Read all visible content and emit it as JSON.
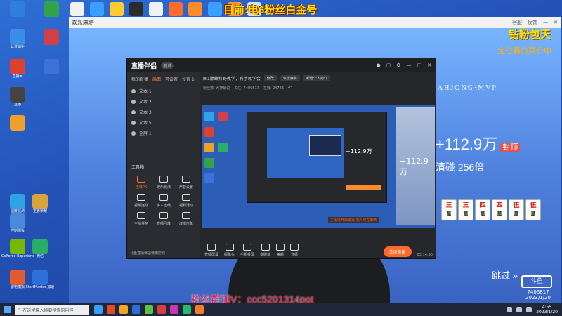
{
  "overlay": {
    "top_text": "目前:电6粉丝白金号",
    "top_right_big": "钻粉包天",
    "top_right_sub": "定位赛白菜价中",
    "fans_text": "粉丝群加V：ccc5201314pot"
  },
  "desktop_icons": [
    {
      "label": "",
      "color": "#2f7fe0"
    },
    {
      "label": "认证助手",
      "color": "#3a8ee6"
    },
    {
      "label": "直播间",
      "color": "#e0402f"
    },
    {
      "label": "直播",
      "color": "#444444"
    },
    {
      "label": "",
      "color": "#f0a02a"
    },
    {
      "label": "",
      "color": "#33a34a"
    },
    {
      "label": "",
      "color": "#d33f49"
    },
    {
      "label": "",
      "color": "#3d73d8"
    },
    {
      "label": "温度监测",
      "color": "#2fa3e6"
    },
    {
      "label": "控制面板",
      "color": "#4a8ad8"
    },
    {
      "label": "王者荣耀",
      "color": "#d8a43a"
    },
    {
      "label": "GeForce Experience",
      "color": "#76b900"
    },
    {
      "label": "微信",
      "color": "#2aae67"
    },
    {
      "label": "雷电模拟",
      "color": "#e45c2d"
    },
    {
      "label": "StartMaster 加速",
      "color": "#2d6fd8"
    }
  ],
  "top_taskbar_icons": [
    "#f2f2f2",
    "#3aa0ff",
    "#ffcb2e",
    "#2b2b2b",
    "#eef2f8",
    "#ff6b2b",
    "#ff8a2a",
    "#3aa0ff",
    "#ff9a2a",
    "#dcdcdc"
  ],
  "game_window": {
    "title": "欢乐麻将",
    "service": "客服",
    "feedback": "反馈",
    "mj_title": "MAHJONG·MVP",
    "score": "+112.9万",
    "score_badge": "封顶",
    "multiplier": "清碰 256倍",
    "tiles": [
      {
        "top": "三",
        "bottom": "萬"
      },
      {
        "top": "三",
        "bottom": "萬"
      },
      {
        "top": "四",
        "bottom": "萬"
      },
      {
        "top": "四",
        "bottom": "萬"
      },
      {
        "top": "伍",
        "bottom": "萬"
      },
      {
        "top": "伍",
        "bottom": "萬"
      }
    ],
    "skip": "跳过 »",
    "platform_logo": "斗鱼",
    "room_id": "7406817",
    "date": "2023/1/20"
  },
  "companion": {
    "brand": "直播伴侣",
    "version": "测试",
    "tabs": [
      "我的直播",
      "画面",
      "可设置",
      "设置 1"
    ],
    "active_tab": "画面",
    "sources": [
      "文本 1",
      "文本 2",
      "文本 3",
      "文本 5",
      "全屏 1"
    ],
    "tools_title": "工具箱",
    "tools": [
      {
        "label": "连线PK",
        "hot": true
      },
      {
        "label": "娱乐玩法",
        "hot": false
      },
      {
        "label": "声音设置",
        "hot": false
      },
      {
        "label": "视频连线",
        "hot": false
      },
      {
        "label": "多人连线",
        "hot": false
      },
      {
        "label": "福利活动",
        "hot": false
      },
      {
        "label": "主播任务",
        "hot": false
      },
      {
        "label": "直播回放",
        "hot": false
      },
      {
        "label": "虚拟形象",
        "hot": false
      }
    ],
    "footer_left": "斗鱼直播伴侣使用帮助",
    "live_title": "国1巅峰打野教学，有手就学会",
    "edit_label": "修改",
    "category": "欢乐麻将",
    "personal": "新增个人简介",
    "stats": [
      "粉丝数: 大神解说",
      "关注: 7406817",
      "在线: 24786",
      "45"
    ],
    "bottom_buttons": [
      "直播屏幕",
      "摄像头",
      "手机投屏",
      "多媒体",
      "美颜",
      "音频"
    ],
    "go_live": "关闭直播",
    "timer": "03:14:30",
    "preview_banner_a": "主播已开启聊天",
    "preview_banner_b": "观众已在聊天"
  },
  "taskbar": {
    "search_placeholder": "在这里输入你要搜索的内容",
    "apps": [
      "#3aa0ff",
      "#e24a2c",
      "#f2a72a",
      "#2d6fd8",
      "#5fbf4a",
      "#d63f3f",
      "#c23bb0",
      "#2bb673",
      "#ff7a2a"
    ],
    "time": "4:55",
    "date": "2023/1/20"
  }
}
